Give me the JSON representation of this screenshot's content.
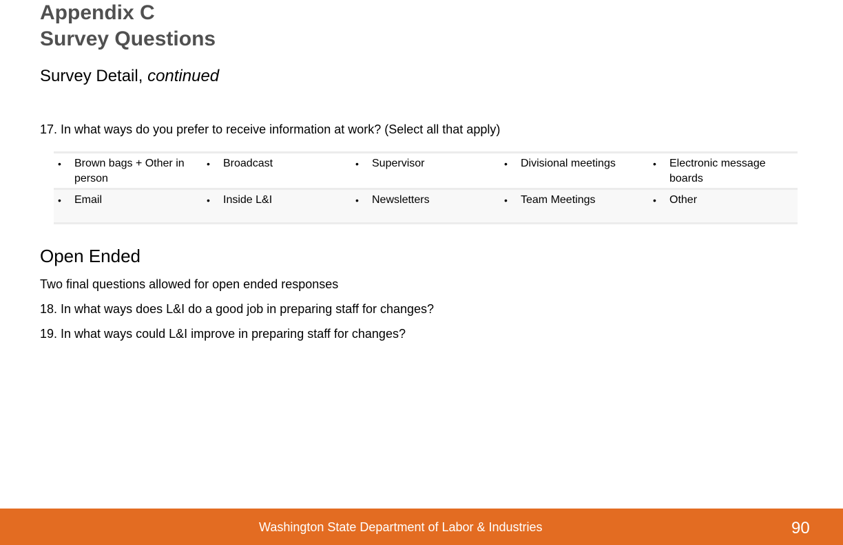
{
  "header": {
    "title_line1": "Appendix C",
    "title_line2": "Survey Questions",
    "subtitle_main": "Survey Detail,",
    "subtitle_italic": "continued"
  },
  "question17": {
    "text": "17. In what ways do you prefer to receive information at work? (Select all that apply)",
    "options": {
      "rows": [
        [
          "Brown bags + Other in person",
          "Broadcast",
          "Supervisor",
          "Divisional meetings",
          "Electronic message boards"
        ],
        [
          "Email",
          "Inside L&I",
          "Newsletters",
          "Team Meetings",
          "Other"
        ]
      ]
    },
    "bullet": "•"
  },
  "open_ended": {
    "heading": "Open Ended",
    "intro": "Two final questions allowed for open ended responses",
    "questions": [
      "18. In what ways does L&I do a good job in preparing staff for changes?",
      "19. In what ways could L&I improve in preparing staff for changes?"
    ]
  },
  "footer": {
    "organization": "Washington State Department of Labor & Industries",
    "page_number": "90",
    "color": "#e36c22"
  }
}
